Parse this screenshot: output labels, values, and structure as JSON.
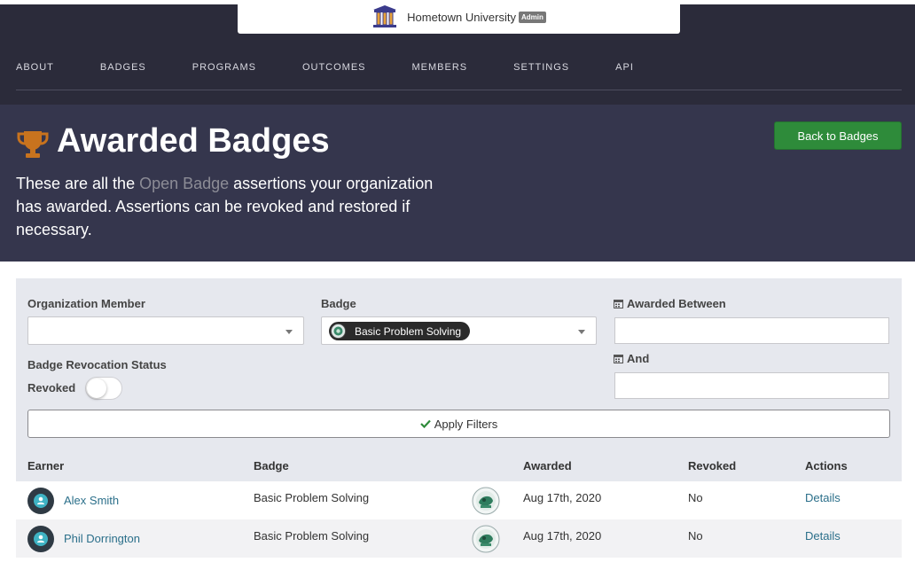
{
  "brand": {
    "name": "Hometown University",
    "role_badge": "Admin"
  },
  "nav": {
    "items": [
      "ABOUT",
      "BADGES",
      "PROGRAMS",
      "OUTCOMES",
      "MEMBERS",
      "SETTINGS",
      "API"
    ]
  },
  "hero": {
    "title": "Awarded Badges",
    "desc_prefix": "These are all the ",
    "desc_link": "Open Badge",
    "desc_suffix": " assertions your organization has awarded. Assertions can be revoked and restored if necessary.",
    "back_button": "Back to Badges"
  },
  "filters": {
    "member_label": "Organization Member",
    "member_value": "",
    "badge_label": "Badge",
    "badge_value": "Basic Problem Solving",
    "awarded_between_label": "Awarded Between",
    "and_label": "And",
    "revocation_label": "Badge Revocation Status",
    "revoked_label": "Revoked",
    "revoked_on": false,
    "apply_button": "Apply Filters"
  },
  "table": {
    "headers": [
      "Earner",
      "Badge",
      "Awarded",
      "Revoked",
      "Actions"
    ],
    "rows": [
      {
        "earner": "Alex Smith",
        "badge": "Basic Problem Solving",
        "awarded": "Aug 17th, 2020",
        "revoked": "No",
        "action": "Details"
      },
      {
        "earner": "Phil Dorrington",
        "badge": "Basic Problem Solving",
        "awarded": "Aug 17th, 2020",
        "revoked": "No",
        "action": "Details"
      }
    ]
  },
  "colors": {
    "nav_bg": "#2b2b3a",
    "hero_bg": "#35364d",
    "accent_green": "#2e8b3a",
    "link": "#2b6f8a",
    "panel_bg": "#e6e8ee"
  }
}
